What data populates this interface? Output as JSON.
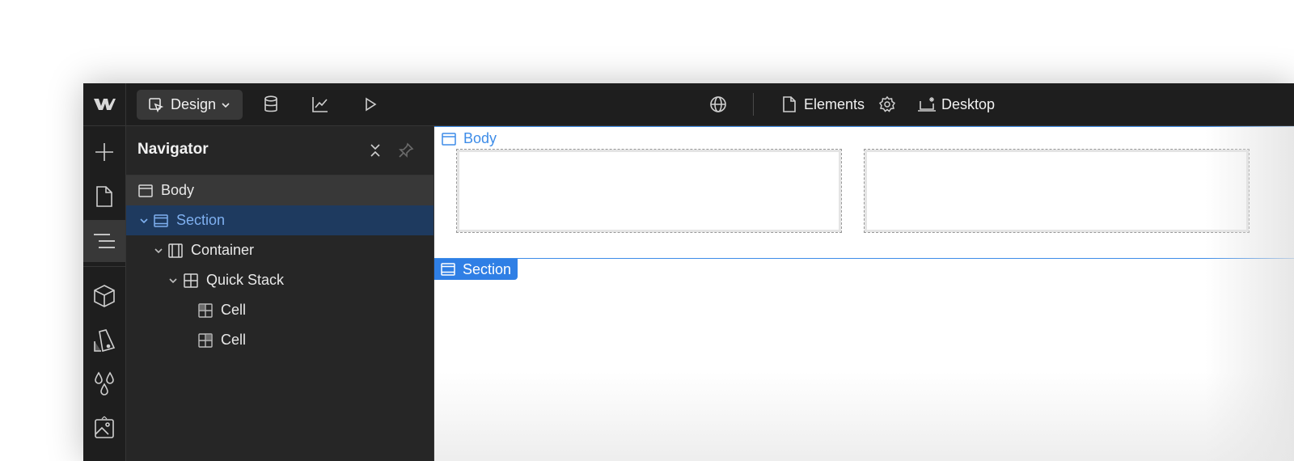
{
  "toolbar": {
    "design_label": "Design",
    "elements_label": "Elements",
    "desktop_label": "Desktop",
    "icons": [
      "webflow-logo-icon",
      "cursor-icon",
      "chevron-down-icon",
      "database-icon",
      "analytics-icon",
      "play-icon",
      "globe-icon",
      "page-icon",
      "gear-icon",
      "breakpoint-icon"
    ]
  },
  "rail": {
    "icons": [
      "add-icon",
      "pages-icon",
      "navigator-icon",
      "components-icon",
      "style-selector-icon",
      "variables-icon",
      "assets-icon"
    ]
  },
  "navigator": {
    "title": "Navigator",
    "items": [
      {
        "label": "Body",
        "icon": "body-icon"
      },
      {
        "label": "Section",
        "icon": "section-icon"
      },
      {
        "label": "Container",
        "icon": "container-icon"
      },
      {
        "label": "Quick Stack",
        "icon": "grid-icon"
      },
      {
        "label": "Cell",
        "icon": "cell-icon"
      },
      {
        "label": "Cell",
        "icon": "cell-icon"
      }
    ]
  },
  "canvas": {
    "body_tag": "Body",
    "section_tag": "Section"
  },
  "colors": {
    "accent": "#3d8ce8",
    "selected_bg": "#1e3a5f",
    "chrome": "#1e1e1e",
    "panel": "#262626"
  }
}
